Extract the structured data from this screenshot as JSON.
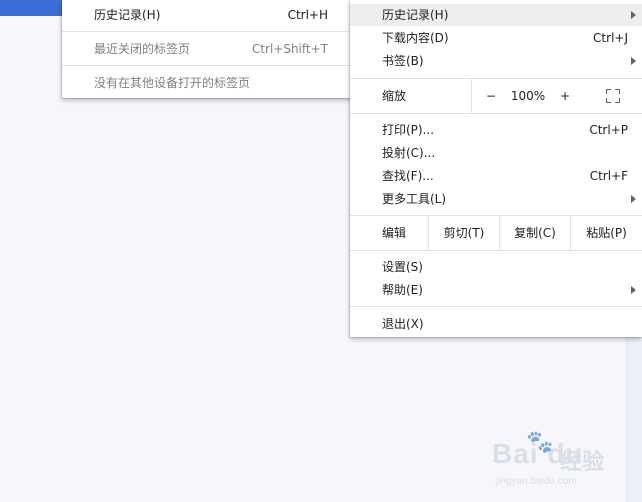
{
  "history_submenu": {
    "items": [
      {
        "label": "历史记录(H)",
        "shortcut": "Ctrl+H"
      },
      {
        "label": "最近关闭的标签页",
        "shortcut": "Ctrl+Shift+T"
      },
      {
        "label": "没有在其他设备打开的标签页"
      }
    ]
  },
  "main_menu": {
    "history": {
      "label": "历史记录(H)"
    },
    "downloads": {
      "label": "下载内容(D)",
      "shortcut": "Ctrl+J"
    },
    "bookmarks": {
      "label": "书签(B)"
    },
    "zoom": {
      "label": "缩放",
      "minus": "−",
      "value": "100%",
      "plus": "+"
    },
    "print": {
      "label": "打印(P)...",
      "shortcut": "Ctrl+P"
    },
    "cast": {
      "label": "投射(C)..."
    },
    "find": {
      "label": "查找(F)...",
      "shortcut": "Ctrl+F"
    },
    "more_tools": {
      "label": "更多工具(L)"
    },
    "edit": {
      "label": "编辑",
      "cut": "剪切(T)",
      "copy": "复制(C)",
      "paste": "粘贴(P)"
    },
    "settings": {
      "label": "设置(S)"
    },
    "help": {
      "label": "帮助(E)"
    },
    "exit": {
      "label": "退出(X)"
    }
  },
  "watermark": {
    "brand": "Bai du",
    "cn": "经验",
    "url": "jingyan.baidu.com"
  },
  "colors": {
    "accent": "#3b6fd8",
    "background": "#f6f7fc",
    "highlight": "#eeeef1"
  }
}
